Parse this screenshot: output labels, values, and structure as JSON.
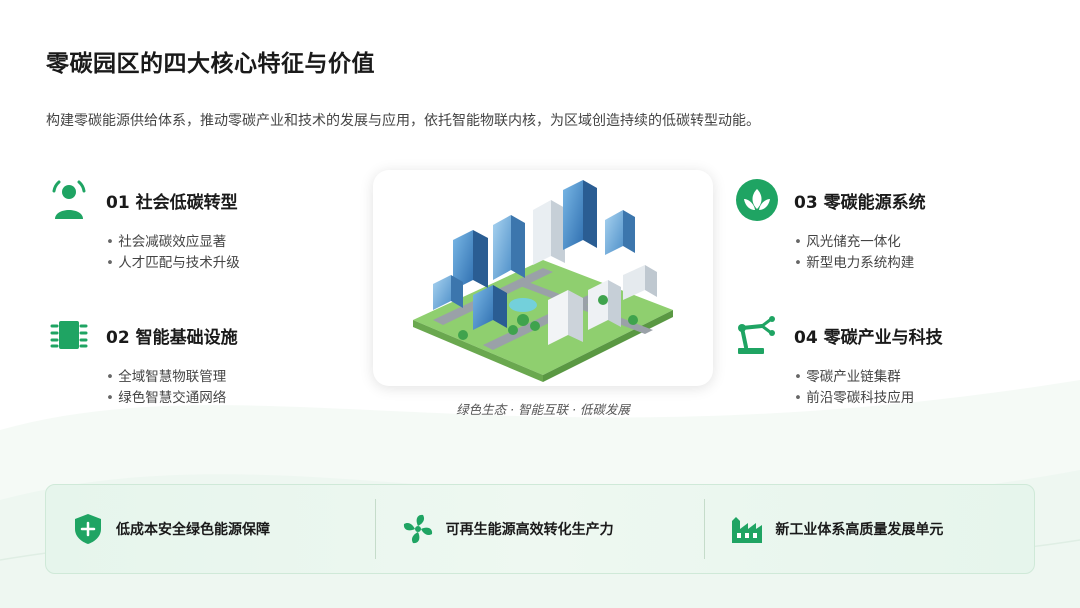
{
  "page": {
    "title": "零碳园区的四大核心特征与价值",
    "subtitle": "构建零碳能源供给体系，推动零碳产业和技术的发展与应用，依托智能物联内核，为区域创造持续的低碳转型动能。"
  },
  "features": [
    {
      "name": "01 社会低碳转型",
      "icon": "person-icon",
      "bullets": [
        "社会减碳效应显著",
        "人才匹配与技术升级"
      ]
    },
    {
      "name": "02 智能基础设施",
      "icon": "chip-icon",
      "bullets": [
        "全域智慧物联管理",
        "绿色智慧交通网络"
      ]
    },
    {
      "name": "03 零碳能源系统",
      "icon": "leaf-icon",
      "bullets": [
        "风光储充一体化",
        "新型电力系统构建"
      ]
    },
    {
      "name": "04 零碳产业与科技",
      "icon": "robot-arm-icon",
      "bullets": [
        "零碳产业链集群",
        "前沿零碳科技应用"
      ]
    }
  ],
  "center": {
    "caption": "绿色生态 · 智能互联 · 低碳发展"
  },
  "bottom": [
    {
      "label": "低成本安全绿色能源保障",
      "icon": "shield-plus-icon"
    },
    {
      "label": "可再生能源高效转化生产力",
      "icon": "fan-icon"
    },
    {
      "label": "新工业体系高质量发展单元",
      "icon": "factory-icon"
    }
  ],
  "colors": {
    "accent": "#1fa463",
    "accent_light": "#e6f5ec"
  }
}
